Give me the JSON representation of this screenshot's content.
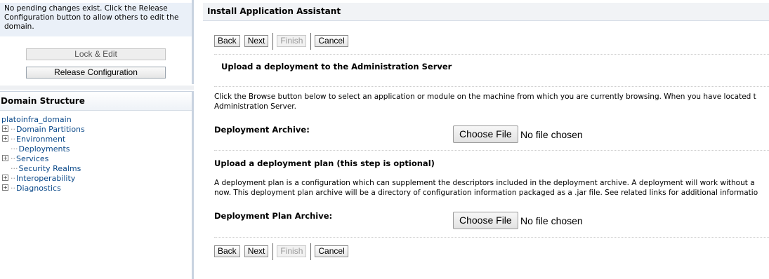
{
  "change_center": {
    "message": "No pending changes exist. Click the Release Configuration button to allow others to edit the domain.",
    "lock_edit_label": "Lock & Edit",
    "release_label": "Release Configuration"
  },
  "domain_structure": {
    "title": "Domain Structure",
    "root": "platoinfra_domain",
    "items": [
      {
        "label": "Domain Partitions",
        "expandable": true
      },
      {
        "label": "Environment",
        "expandable": true
      },
      {
        "label": "Deployments",
        "expandable": false
      },
      {
        "label": "Services",
        "expandable": true
      },
      {
        "label": "Security Realms",
        "expandable": false
      },
      {
        "label": "Interoperability",
        "expandable": true
      },
      {
        "label": "Diagnostics",
        "expandable": true
      }
    ]
  },
  "assistant": {
    "title": "Install Application Assistant",
    "buttons": {
      "back": "Back",
      "next": "Next",
      "finish": "Finish",
      "cancel": "Cancel"
    },
    "upload_heading": "Upload a deployment to the Administration Server",
    "upload_text_1": "Click the Browse button below to select an application or module on the machine from which you are currently browsing. When you have located t",
    "upload_text_2": "Administration Server.",
    "archive_label": "Deployment Archive:",
    "choose_file": "Choose File",
    "no_file": "No file chosen",
    "plan_heading": "Upload a deployment plan (this step is optional)",
    "plan_text_1": "A deployment plan is a configuration which can supplement the descriptors included in the deployment archive. A deployment will work without a",
    "plan_text_2": "now. This deployment plan archive will be a directory of configuration information packaged as a .jar file. See related links for additional informatio",
    "plan_label": "Deployment Plan Archive:"
  }
}
